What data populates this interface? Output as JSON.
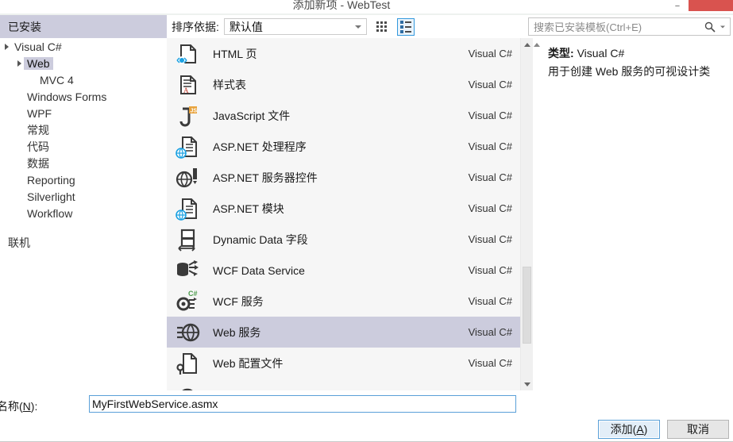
{
  "window": {
    "title": "添加新项 - WebTest",
    "minimize_label": "−",
    "close_label": ""
  },
  "installed_header": {
    "label": "已安装"
  },
  "toolbar": {
    "sort_label": "排序依据:",
    "sort_value": "默认值",
    "tiles_view_name": "tiles-view",
    "list_view_name": "list-view"
  },
  "search": {
    "placeholder": "搜索已安装模板(Ctrl+E)"
  },
  "tree": {
    "items": [
      {
        "label": "Visual C#",
        "indent": 0,
        "expander": "expanded",
        "selected": false
      },
      {
        "label": "Web",
        "indent": 1,
        "expander": "expanded",
        "selected": true
      },
      {
        "label": "MVC 4",
        "indent": 2,
        "expander": "none",
        "selected": false
      },
      {
        "label": "Windows Forms",
        "indent": 1,
        "expander": "none",
        "selected": false
      },
      {
        "label": "WPF",
        "indent": 1,
        "expander": "none",
        "selected": false
      },
      {
        "label": "常规",
        "indent": 1,
        "expander": "none",
        "selected": false
      },
      {
        "label": "代码",
        "indent": 1,
        "expander": "none",
        "selected": false
      },
      {
        "label": "数据",
        "indent": 1,
        "expander": "none",
        "selected": false
      },
      {
        "label": "Reporting",
        "indent": 1,
        "expander": "none",
        "selected": false
      },
      {
        "label": "Silverlight",
        "indent": 1,
        "expander": "none",
        "selected": false
      },
      {
        "label": "Workflow",
        "indent": 1,
        "expander": "none",
        "selected": false
      }
    ],
    "online_label": "联机"
  },
  "templates": {
    "language_column": "Visual C#",
    "items": [
      {
        "name": "HTML 页",
        "language": "Visual C#",
        "icon": "html-page-icon",
        "selected": false
      },
      {
        "name": "样式表",
        "language": "Visual C#",
        "icon": "stylesheet-icon",
        "selected": false
      },
      {
        "name": "JavaScript 文件",
        "language": "Visual C#",
        "icon": "javascript-file-icon",
        "selected": false
      },
      {
        "name": "ASP.NET 处理程序",
        "language": "Visual C#",
        "icon": "aspnet-handler-icon",
        "selected": false
      },
      {
        "name": "ASP.NET 服务器控件",
        "language": "Visual C#",
        "icon": "aspnet-server-control-icon",
        "selected": false
      },
      {
        "name": "ASP.NET 模块",
        "language": "Visual C#",
        "icon": "aspnet-module-icon",
        "selected": false
      },
      {
        "name": "Dynamic Data 字段",
        "language": "Visual C#",
        "icon": "dynamic-data-field-icon",
        "selected": false
      },
      {
        "name": "WCF Data Service",
        "language": "Visual C#",
        "icon": "wcf-data-service-icon",
        "selected": false
      },
      {
        "name": "WCF 服务",
        "language": "Visual C#",
        "icon": "wcf-service-icon",
        "selected": false
      },
      {
        "name": "Web 服务",
        "language": "Visual C#",
        "icon": "web-service-icon",
        "selected": true
      },
      {
        "name": "Web 配置文件",
        "language": "Visual C#",
        "icon": "web-config-file-icon",
        "selected": false
      }
    ]
  },
  "detail": {
    "type_label": "类型:",
    "type_value": "Visual C#",
    "description": "用于创建 Web 服务的可视设计类"
  },
  "name_field": {
    "label_prefix": "名称(",
    "label_accel": "N",
    "label_suffix": "):",
    "value": "MyFirstWebService.asmx"
  },
  "buttons": {
    "add_prefix": "添加(",
    "add_accel": "A",
    "add_suffix": ")",
    "cancel": "取消"
  },
  "colors": {
    "selection": "#ccccdd",
    "focus_border": "#5aa0d8",
    "close_button": "#d9534f",
    "list_background": "#f6f6f6"
  }
}
